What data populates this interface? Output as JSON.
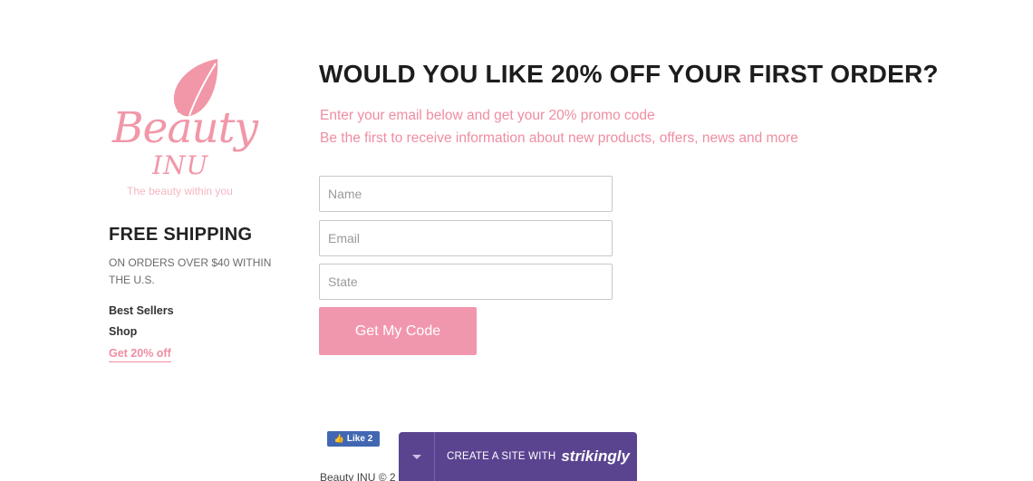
{
  "brand": {
    "name": "Beauty",
    "name_line2": "INU",
    "tagline": "The beauty within you"
  },
  "shipping": {
    "title": "FREE SHIPPING",
    "subtitle": "ON ORDERS OVER $40 WITHIN THE U.S."
  },
  "nav": {
    "items": [
      {
        "label": "Best Sellers"
      },
      {
        "label": "Shop"
      },
      {
        "label": "Get 20% off"
      }
    ]
  },
  "promo": {
    "headline": "WOULD YOU LIKE 20% OFF YOUR FIRST ORDER?",
    "line1": "Enter your email below and get your 20% promo code",
    "line2": "Be the first to receive information about new products, offers, news and more"
  },
  "form": {
    "name_placeholder": "Name",
    "email_placeholder": "Email",
    "state_placeholder": "State",
    "submit_label": "Get My Code"
  },
  "social": {
    "like_label": "Like 2"
  },
  "footer": {
    "copyright": "Beauty INU © 2"
  },
  "strikingly_bar": {
    "cta": "CREATE A SITE WITH",
    "brand": "strikingly"
  },
  "colors": {
    "accent_pink": "#f197ad",
    "bar_purple": "#5a4490",
    "facebook_blue": "#4267b2"
  },
  "icons": {
    "logo": "leaf-icon",
    "bar_toggle": "caret-down-icon",
    "like": "thumbs-up-icon"
  }
}
